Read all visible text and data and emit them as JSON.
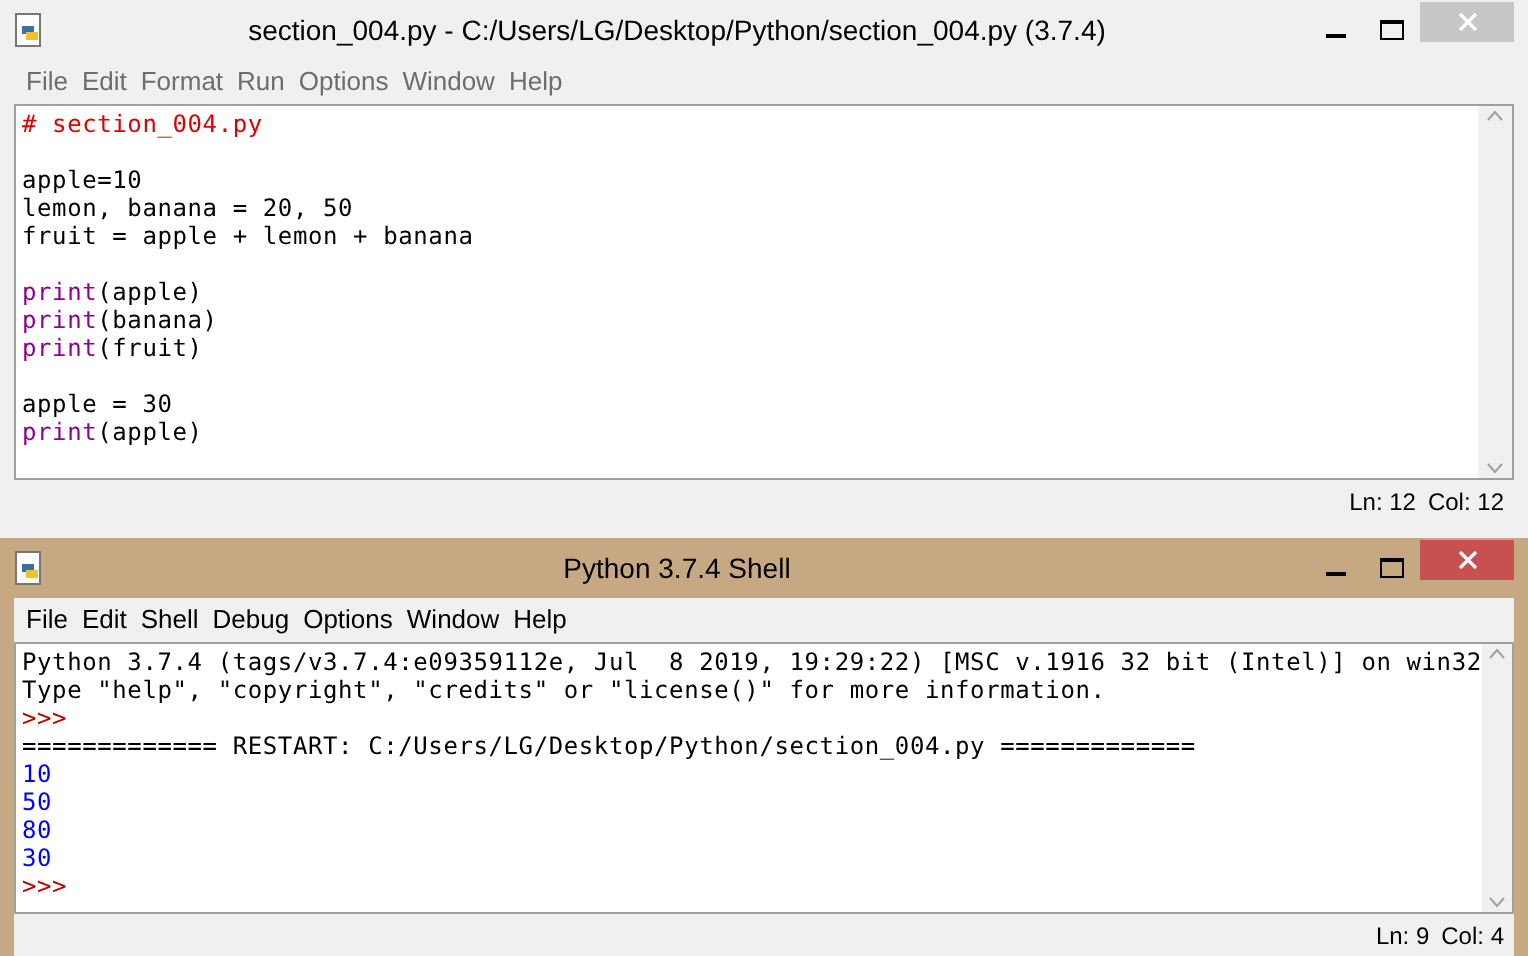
{
  "editor_window": {
    "title": "section_004.py - C:/Users/LG/Desktop/Python/section_004.py (3.7.4)",
    "active": false,
    "menu": [
      "File",
      "Edit",
      "Format",
      "Run",
      "Options",
      "Window",
      "Help"
    ],
    "lines": [
      {
        "segments": [
          {
            "text": "# section_004.py",
            "kind": "comment"
          }
        ]
      },
      {
        "kind": "blank"
      },
      {
        "segments": [
          {
            "text": "apple=10",
            "kind": "plain"
          }
        ]
      },
      {
        "segments": [
          {
            "text": "lemon, banana = 20, 50",
            "kind": "plain"
          }
        ]
      },
      {
        "segments": [
          {
            "text": "fruit = apple + lemon + banana",
            "kind": "plain"
          }
        ]
      },
      {
        "kind": "blank"
      },
      {
        "segments": [
          {
            "text": "print",
            "kind": "builtin"
          },
          {
            "text": "(apple)",
            "kind": "plain"
          }
        ]
      },
      {
        "segments": [
          {
            "text": "print",
            "kind": "builtin"
          },
          {
            "text": "(banana)",
            "kind": "plain"
          }
        ]
      },
      {
        "segments": [
          {
            "text": "print",
            "kind": "builtin"
          },
          {
            "text": "(fruit)",
            "kind": "plain"
          }
        ]
      },
      {
        "kind": "blank"
      },
      {
        "segments": [
          {
            "text": "apple = 30",
            "kind": "plain"
          }
        ]
      },
      {
        "segments": [
          {
            "text": "print",
            "kind": "builtin"
          },
          {
            "text": "(apple)",
            "kind": "plain"
          }
        ]
      }
    ],
    "status": [
      "Ln: 12",
      "Col: 12"
    ]
  },
  "shell_window": {
    "title": "Python 3.7.4 Shell",
    "active": true,
    "menu": [
      "File",
      "Edit",
      "Shell",
      "Debug",
      "Options",
      "Window",
      "Help"
    ],
    "lines": [
      {
        "segments": [
          {
            "text": "Python 3.7.4 (tags/v3.7.4:e09359112e, Jul  8 2019, 19:29:22) [MSC v.1916 32 bit (Intel)] on win32",
            "kind": "plain"
          }
        ]
      },
      {
        "segments": [
          {
            "text": "Type \"help\", \"copyright\", \"credits\" or \"license()\" for more information.",
            "kind": "plain"
          }
        ]
      },
      {
        "segments": [
          {
            "text": ">>>",
            "kind": "prompt"
          }
        ]
      },
      {
        "segments": [
          {
            "text": "============= RESTART: C:/Users/LG/Desktop/Python/section_004.py =============",
            "kind": "plain"
          }
        ]
      },
      {
        "segments": [
          {
            "text": "10",
            "kind": "output"
          }
        ]
      },
      {
        "segments": [
          {
            "text": "50",
            "kind": "output"
          }
        ]
      },
      {
        "segments": [
          {
            "text": "80",
            "kind": "output"
          }
        ]
      },
      {
        "segments": [
          {
            "text": "30",
            "kind": "output"
          }
        ]
      },
      {
        "segments": [
          {
            "text": ">>>",
            "kind": "prompt"
          }
        ]
      }
    ],
    "status": [
      "Ln: 9",
      "Col: 4"
    ]
  }
}
